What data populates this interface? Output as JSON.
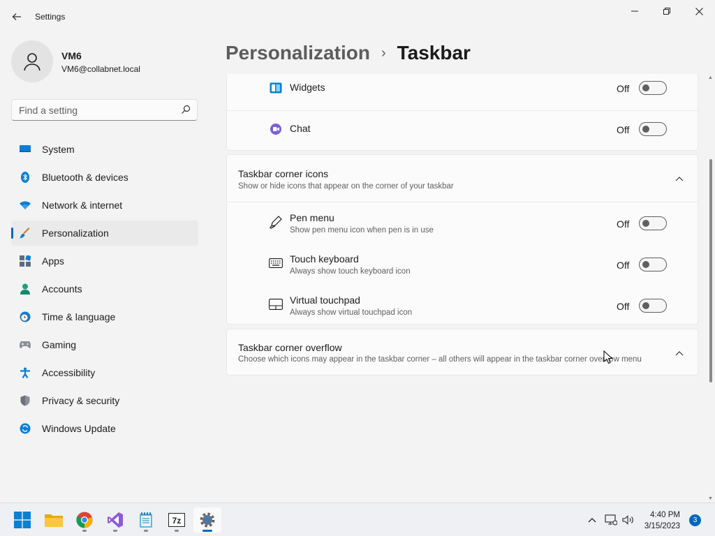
{
  "window": {
    "title": "Settings",
    "back_icon": "arrow-left-icon"
  },
  "user": {
    "name": "VM6",
    "email": "VM6@collabnet.local"
  },
  "search": {
    "placeholder": "Find a setting"
  },
  "sidebar": {
    "items": [
      {
        "label": "System",
        "icon": "monitor-icon"
      },
      {
        "label": "Bluetooth & devices",
        "icon": "bluetooth-icon"
      },
      {
        "label": "Network & internet",
        "icon": "wifi-icon"
      },
      {
        "label": "Personalization",
        "icon": "brush-icon",
        "active": true
      },
      {
        "label": "Apps",
        "icon": "apps-icon"
      },
      {
        "label": "Accounts",
        "icon": "person-icon"
      },
      {
        "label": "Time & language",
        "icon": "clock-globe-icon"
      },
      {
        "label": "Gaming",
        "icon": "gamepad-icon"
      },
      {
        "label": "Accessibility",
        "icon": "accessibility-icon"
      },
      {
        "label": "Privacy & security",
        "icon": "shield-icon"
      },
      {
        "label": "Windows Update",
        "icon": "update-icon"
      }
    ]
  },
  "breadcrumb": {
    "parent": "Personalization",
    "separator": "›",
    "current": "Taskbar"
  },
  "taskbar_items": {
    "widgets": {
      "title": "Widgets",
      "state": "Off",
      "on": false
    },
    "chat": {
      "title": "Chat",
      "state": "Off",
      "on": false
    }
  },
  "corner_icons": {
    "title": "Taskbar corner icons",
    "description": "Show or hide icons that appear on the corner of your taskbar",
    "expanded": true,
    "items": [
      {
        "title": "Pen menu",
        "description": "Show pen menu icon when pen is in use",
        "state": "Off",
        "icon": "pen-icon"
      },
      {
        "title": "Touch keyboard",
        "description": "Always show touch keyboard icon",
        "state": "Off",
        "icon": "keyboard-icon"
      },
      {
        "title": "Virtual touchpad",
        "description": "Always show virtual touchpad icon",
        "state": "Off",
        "icon": "touchpad-icon"
      }
    ]
  },
  "corner_overflow": {
    "title": "Taskbar corner overflow",
    "description": "Choose which icons may appear in the taskbar corner – all others will appear in the taskbar corner overflow menu",
    "expanded": false
  },
  "taskbar": {
    "apps": [
      "start-icon",
      "file-explorer-icon",
      "chrome-icon",
      "visual-studio-icon",
      "notepad-icon",
      "7zip-icon",
      "settings-icon"
    ],
    "time": "4:40 PM",
    "date": "3/15/2023",
    "notifications": "3"
  },
  "colors": {
    "accent": "#0067c0",
    "background": "#f3f3f3",
    "card": "#fbfbfb"
  }
}
